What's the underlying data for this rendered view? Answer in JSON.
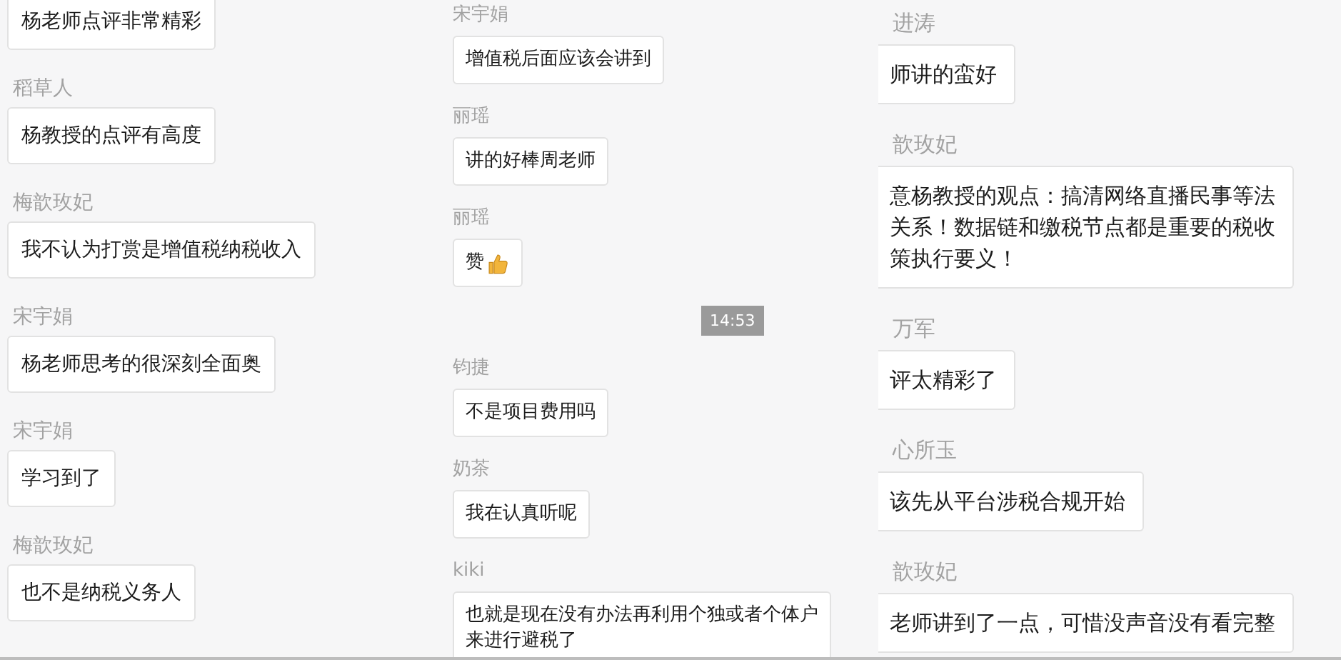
{
  "columns": [
    {
      "messages": [
        {
          "kind": "text",
          "lines": [
            "杨老师点评非常精彩"
          ]
        },
        {
          "kind": "text",
          "sender": "稻草人",
          "lines": [
            "杨教授的点评有高度"
          ]
        },
        {
          "kind": "text",
          "sender": "梅歆玫妃",
          "lines": [
            "我不认为打赏是增值税纳税收入"
          ]
        },
        {
          "kind": "text",
          "sender": "宋宇娟",
          "lines": [
            "杨老师思考的很深刻全面奥"
          ]
        },
        {
          "kind": "text",
          "sender": "宋宇娟",
          "lines": [
            "学习到了"
          ]
        },
        {
          "kind": "text",
          "sender": "梅歆玫妃",
          "lines": [
            "也不是纳税义务人"
          ]
        }
      ]
    },
    {
      "messages": [
        {
          "kind": "text",
          "sender": "宋宇娟",
          "lines": [
            "增值税后面应该会讲到"
          ]
        },
        {
          "kind": "text",
          "sender": "丽瑶",
          "lines": [
            "讲的好棒周老师"
          ]
        },
        {
          "kind": "emoji",
          "sender": "丽瑶",
          "lines": [
            "赞"
          ]
        },
        {
          "kind": "time",
          "lines": [
            "14:53"
          ]
        },
        {
          "kind": "text",
          "sender": "钧捷",
          "lines": [
            "不是项目费用吗"
          ]
        },
        {
          "kind": "text",
          "sender": "奶茶",
          "lines": [
            "我在认真听呢"
          ]
        },
        {
          "kind": "text",
          "sender": "kiki",
          "lines": [
            "也就是现在没有办法再利用个独或者个体户",
            "来进行避税了"
          ]
        }
      ]
    },
    {
      "messages": [
        {
          "kind": "text",
          "sender": "进涛",
          "lines": [
            "师讲的蛮好"
          ]
        },
        {
          "kind": "text",
          "sender": "歆玫妃",
          "lines": [
            "意杨教授的观点：搞清网络直播民事等法",
            "关系！数据链和缴税节点都是重要的税收",
            "策执行要义！"
          ]
        },
        {
          "kind": "text",
          "sender": "万军",
          "lines": [
            "评太精彩了"
          ]
        },
        {
          "kind": "text",
          "sender": "心所玉",
          "lines": [
            "该先从平台涉税合规开始"
          ]
        },
        {
          "kind": "text",
          "sender": "歆玫妃",
          "lines": [
            "老师讲到了一点，可惜没声音没有看完整"
          ]
        }
      ]
    }
  ]
}
